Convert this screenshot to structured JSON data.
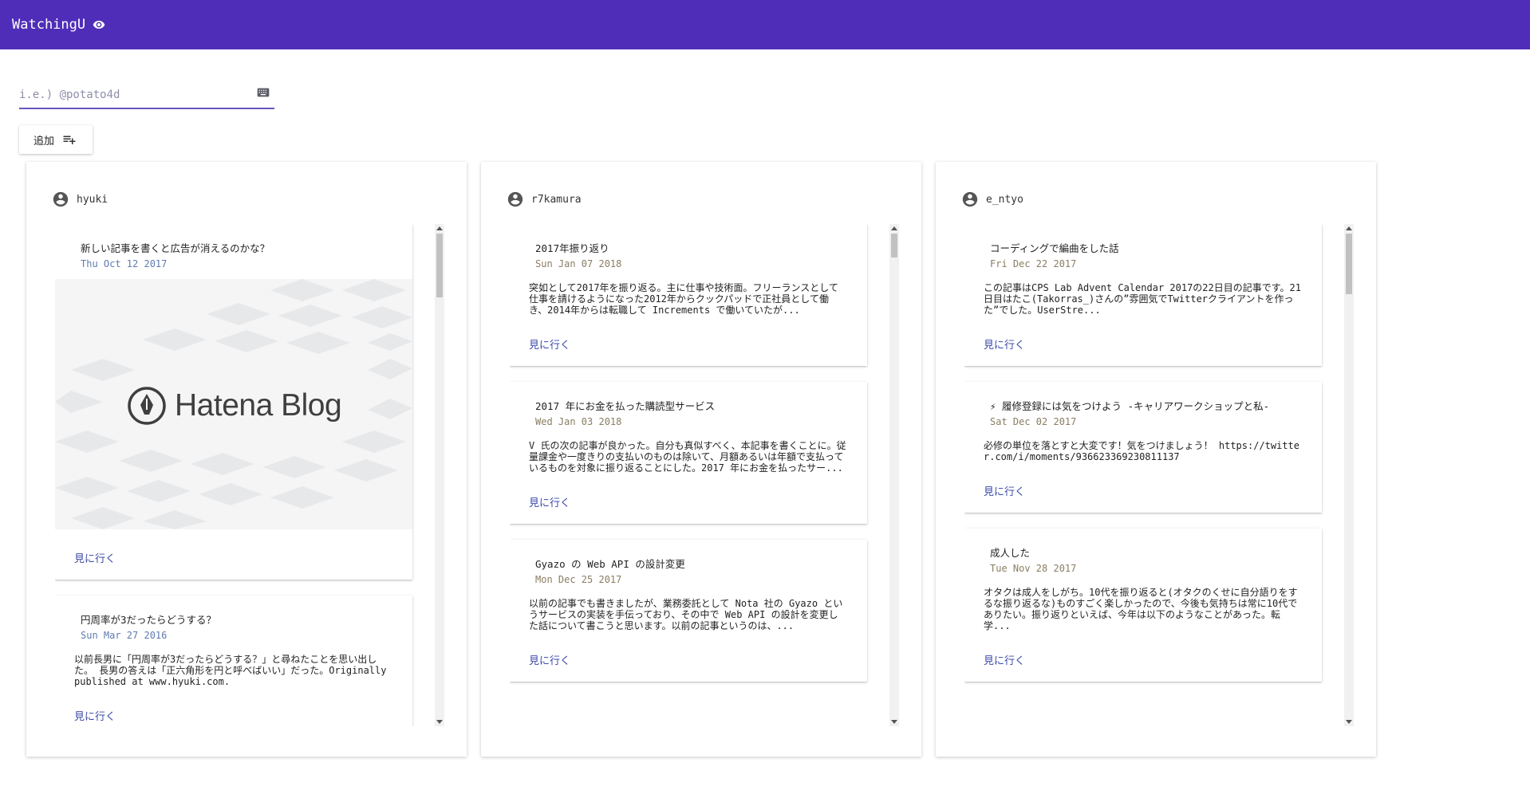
{
  "app": {
    "title": "WatchingU",
    "icon": "eye-icon"
  },
  "search": {
    "placeholder": "i.e.) @potato4d",
    "value": "",
    "icon": "keyboard-icon"
  },
  "add_button": {
    "label": "追加",
    "icon": "playlist-add-icon"
  },
  "colors": {
    "primary": "#4f2db8",
    "link": "#3c4aa8",
    "date_brown": "#8a7d62",
    "date_blue": "#5f7bb0"
  },
  "columns": [
    {
      "user": "hyuki",
      "user_icon": "account-circle-icon",
      "cards": [
        {
          "title": "新しい記事を書くと広告が消えるのかな？",
          "date": "Thu Oct 12 2017",
          "image": {
            "logo_text": "Hatena Blog"
          },
          "link": "見に行く"
        },
        {
          "title": "円周率が3だったらどうする？",
          "date": "Sun Mar 27 2016",
          "body": "以前長男に「円周率が3だったらどうする？」と尋ねたことを思い出した。 長男の答えは「正六角形を円と呼べばいい」だった。Originally published at www.hyuki.com.",
          "link": "見に行く"
        }
      ]
    },
    {
      "user": "r7kamura",
      "user_icon": "account-circle-icon",
      "cards": [
        {
          "title": "2017年振り返り",
          "date": "Sun Jan 07 2018",
          "body": "突如として2017年を振り返る。主に仕事や技術面。フリーランスとして仕事を請けるようになった2012年からクックパッドで正社員として働き、2014年からは転職して Increments で働いていたが...",
          "link": "見に行く"
        },
        {
          "title": "2017 年にお金を払った購読型サービス",
          "date": "Wed Jan 03 2018",
          "body": "V 氏の次の記事が良かった。自分も真似すべく、本記事を書くことに。従量課金や一度きりの支払いのものは除いて、月額あるいは年額で支払っているものを対象に振り返ることにした。2017 年にお金を払ったサー...",
          "link": "見に行く"
        },
        {
          "title": "Gyazo の Web API の設計変更",
          "date": "Mon Dec 25 2017",
          "body": "以前の記事でも書きましたが、業務委託として Nota 社の Gyazo というサービスの実装を手伝っており、その中で Web API の設計を変更した話について書こうと思います。以前の記事というのは、...",
          "link": "見に行く"
        }
      ]
    },
    {
      "user": "e_ntyo",
      "user_icon": "account-circle-icon",
      "cards": [
        {
          "title": "コーディングで編曲をした話",
          "date": "Fri Dec 22 2017",
          "body": "この記事はCPS Lab Advent Calendar 2017の22日目の記事です。21日目はたこ(Takorras_)さんの”雰囲気でTwitterクライアントを作った”でした。UserStre...",
          "link": "見に行く"
        },
        {
          "title": "⚡ 履修登録には気をつけよう -キャリアワークショップと私-",
          "date": "Sat Dec 02 2017",
          "body": "必修の単位を落とすと大変です！気をつけましょう！ https://twitter.com/i/moments/936623369230811137",
          "link": "見に行く"
        },
        {
          "title": "成人した",
          "date": "Tue Nov 28 2017",
          "body": "オタクは成人をしがち。10代を振り返ると(オタクのくせに自分語りをするな振り返るな)ものすごく楽しかったので、今後も気持ちは常に10代でありたい。振り返りといえば、今年は以下のようなことがあった。転学...",
          "link": "見に行く"
        }
      ]
    }
  ]
}
